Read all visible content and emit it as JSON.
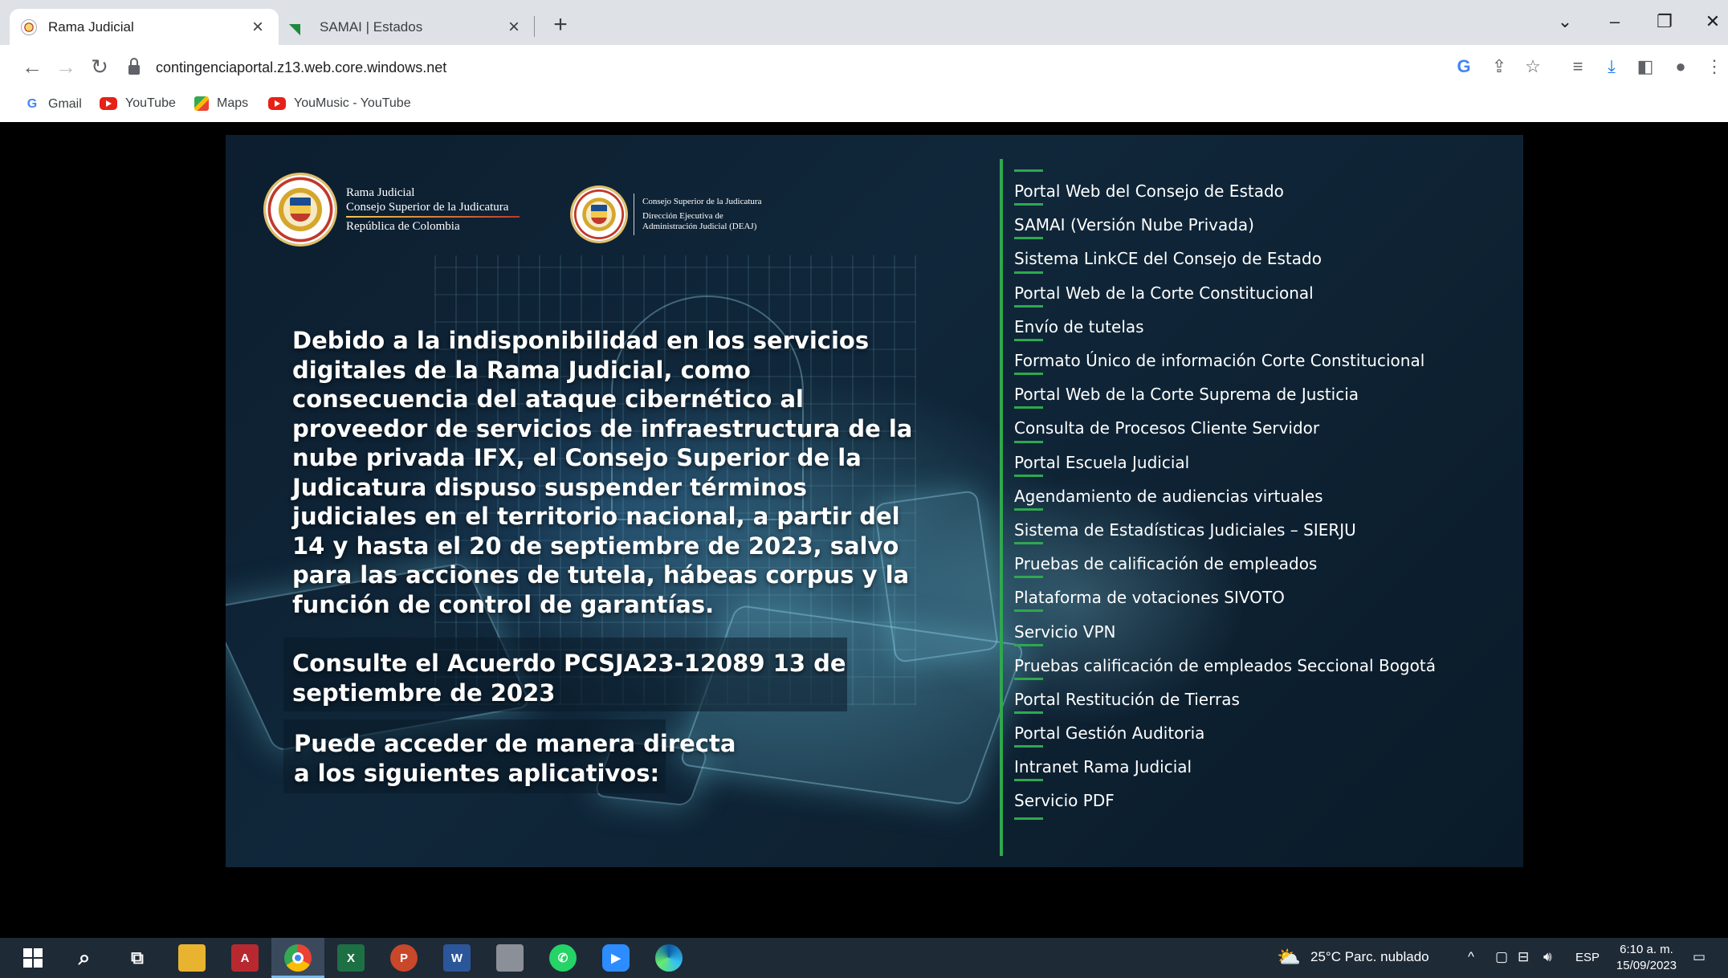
{
  "browser": {
    "tabs": [
      {
        "title": "Rama Judicial",
        "active": true
      },
      {
        "title": "SAMAI | Estados",
        "active": false
      }
    ],
    "url": "contingenciaportal.z13.web.core.windows.net",
    "bookmarks": [
      {
        "label": "Gmail",
        "icon": "google-icon"
      },
      {
        "label": "YouTube",
        "icon": "youtube-icon"
      },
      {
        "label": "Maps",
        "icon": "maps-icon"
      },
      {
        "label": "YouMusic - YouTube",
        "icon": "youtube-icon"
      }
    ]
  },
  "page": {
    "logo1": {
      "line1": "Rama Judicial",
      "line2": "Consejo Superior de la Judicatura",
      "line3": "República de Colombia"
    },
    "logo2": {
      "line1": "Consejo Superior de la Judicatura",
      "line2": "Dirección Ejecutiva de",
      "line3": "Administración Judicial (DEAJ)"
    },
    "headline": "Debido a la indisponibilidad en los servicios digitales de la Rama Judicial, como consecuencia del ataque cibernético al proveedor de servicios de infraestructura de la nube privada IFX, el Consejo Superior de la Judicatura dispuso suspender términos judiciales en el territorio nacional, a partir del 14 y hasta el 20 de septiembre de 2023, salvo para las acciones de tutela, hábeas corpus y la función de control de garantías.",
    "acuerdo": "Consulte el Acuerdo PCSJA23-12089 13 de septiembre de 2023",
    "acceso": "Puede acceder de manera directa a los siguientes aplicativos:",
    "links": [
      "Portal Web del Consejo de Estado",
      "SAMAI (Versión Nube Privada)",
      "Sistema LinkCE del Consejo de Estado",
      "Portal Web de la Corte Constitucional",
      "Envío de tutelas",
      "Formato Único de información Corte Constitucional",
      "Portal Web de la Corte Suprema de Justicia",
      "Consulta de Procesos Cliente Servidor",
      "Portal Escuela Judicial",
      "Agendamiento de audiencias virtuales",
      "Sistema de Estadísticas Judiciales – SIERJU",
      "Pruebas de calificación de empleados",
      "Plataforma de votaciones SIVOTO",
      "Servicio VPN",
      "Pruebas calificación de empleados Seccional Bogotá",
      "Portal Restitución de Tierras",
      "Portal Gestión Auditoria",
      "Intranet Rama Judicial",
      "Servicio PDF"
    ],
    "accent_color": "#2fa84f"
  },
  "taskbar": {
    "weather": "25°C  Parc. nublado",
    "lang": "ESP",
    "time": "6:10 a. m.",
    "date": "15/09/2023"
  }
}
